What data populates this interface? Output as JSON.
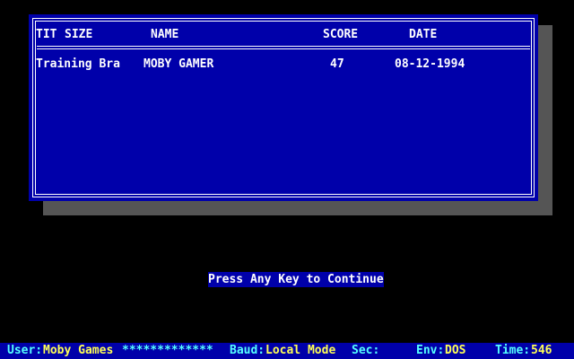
{
  "table": {
    "headers": {
      "title": "TIT",
      "size": "SIZE",
      "name": "NAME",
      "score": "SCORE",
      "date": "DATE"
    },
    "rows": [
      {
        "title": "Training Bra",
        "name": "MOBY GAMER",
        "score": "47",
        "date": "08-12-1994"
      }
    ]
  },
  "prompt": "Press Any Key to Continue",
  "status_bar": {
    "user_label": "User:",
    "user_value": "Moby Games",
    "masked": "*************",
    "baud_label": "Baud:",
    "baud_value": "Local Mode",
    "sec_label": "Sec:",
    "env_label": "Env:",
    "env_value": "DOS",
    "time_label": "Time:",
    "time_value": "546"
  },
  "colors": {
    "panel": "#0000aa",
    "shadow": "#555555",
    "text": "#ffffff",
    "status_label": "#55ffff",
    "status_value": "#ffff55"
  }
}
